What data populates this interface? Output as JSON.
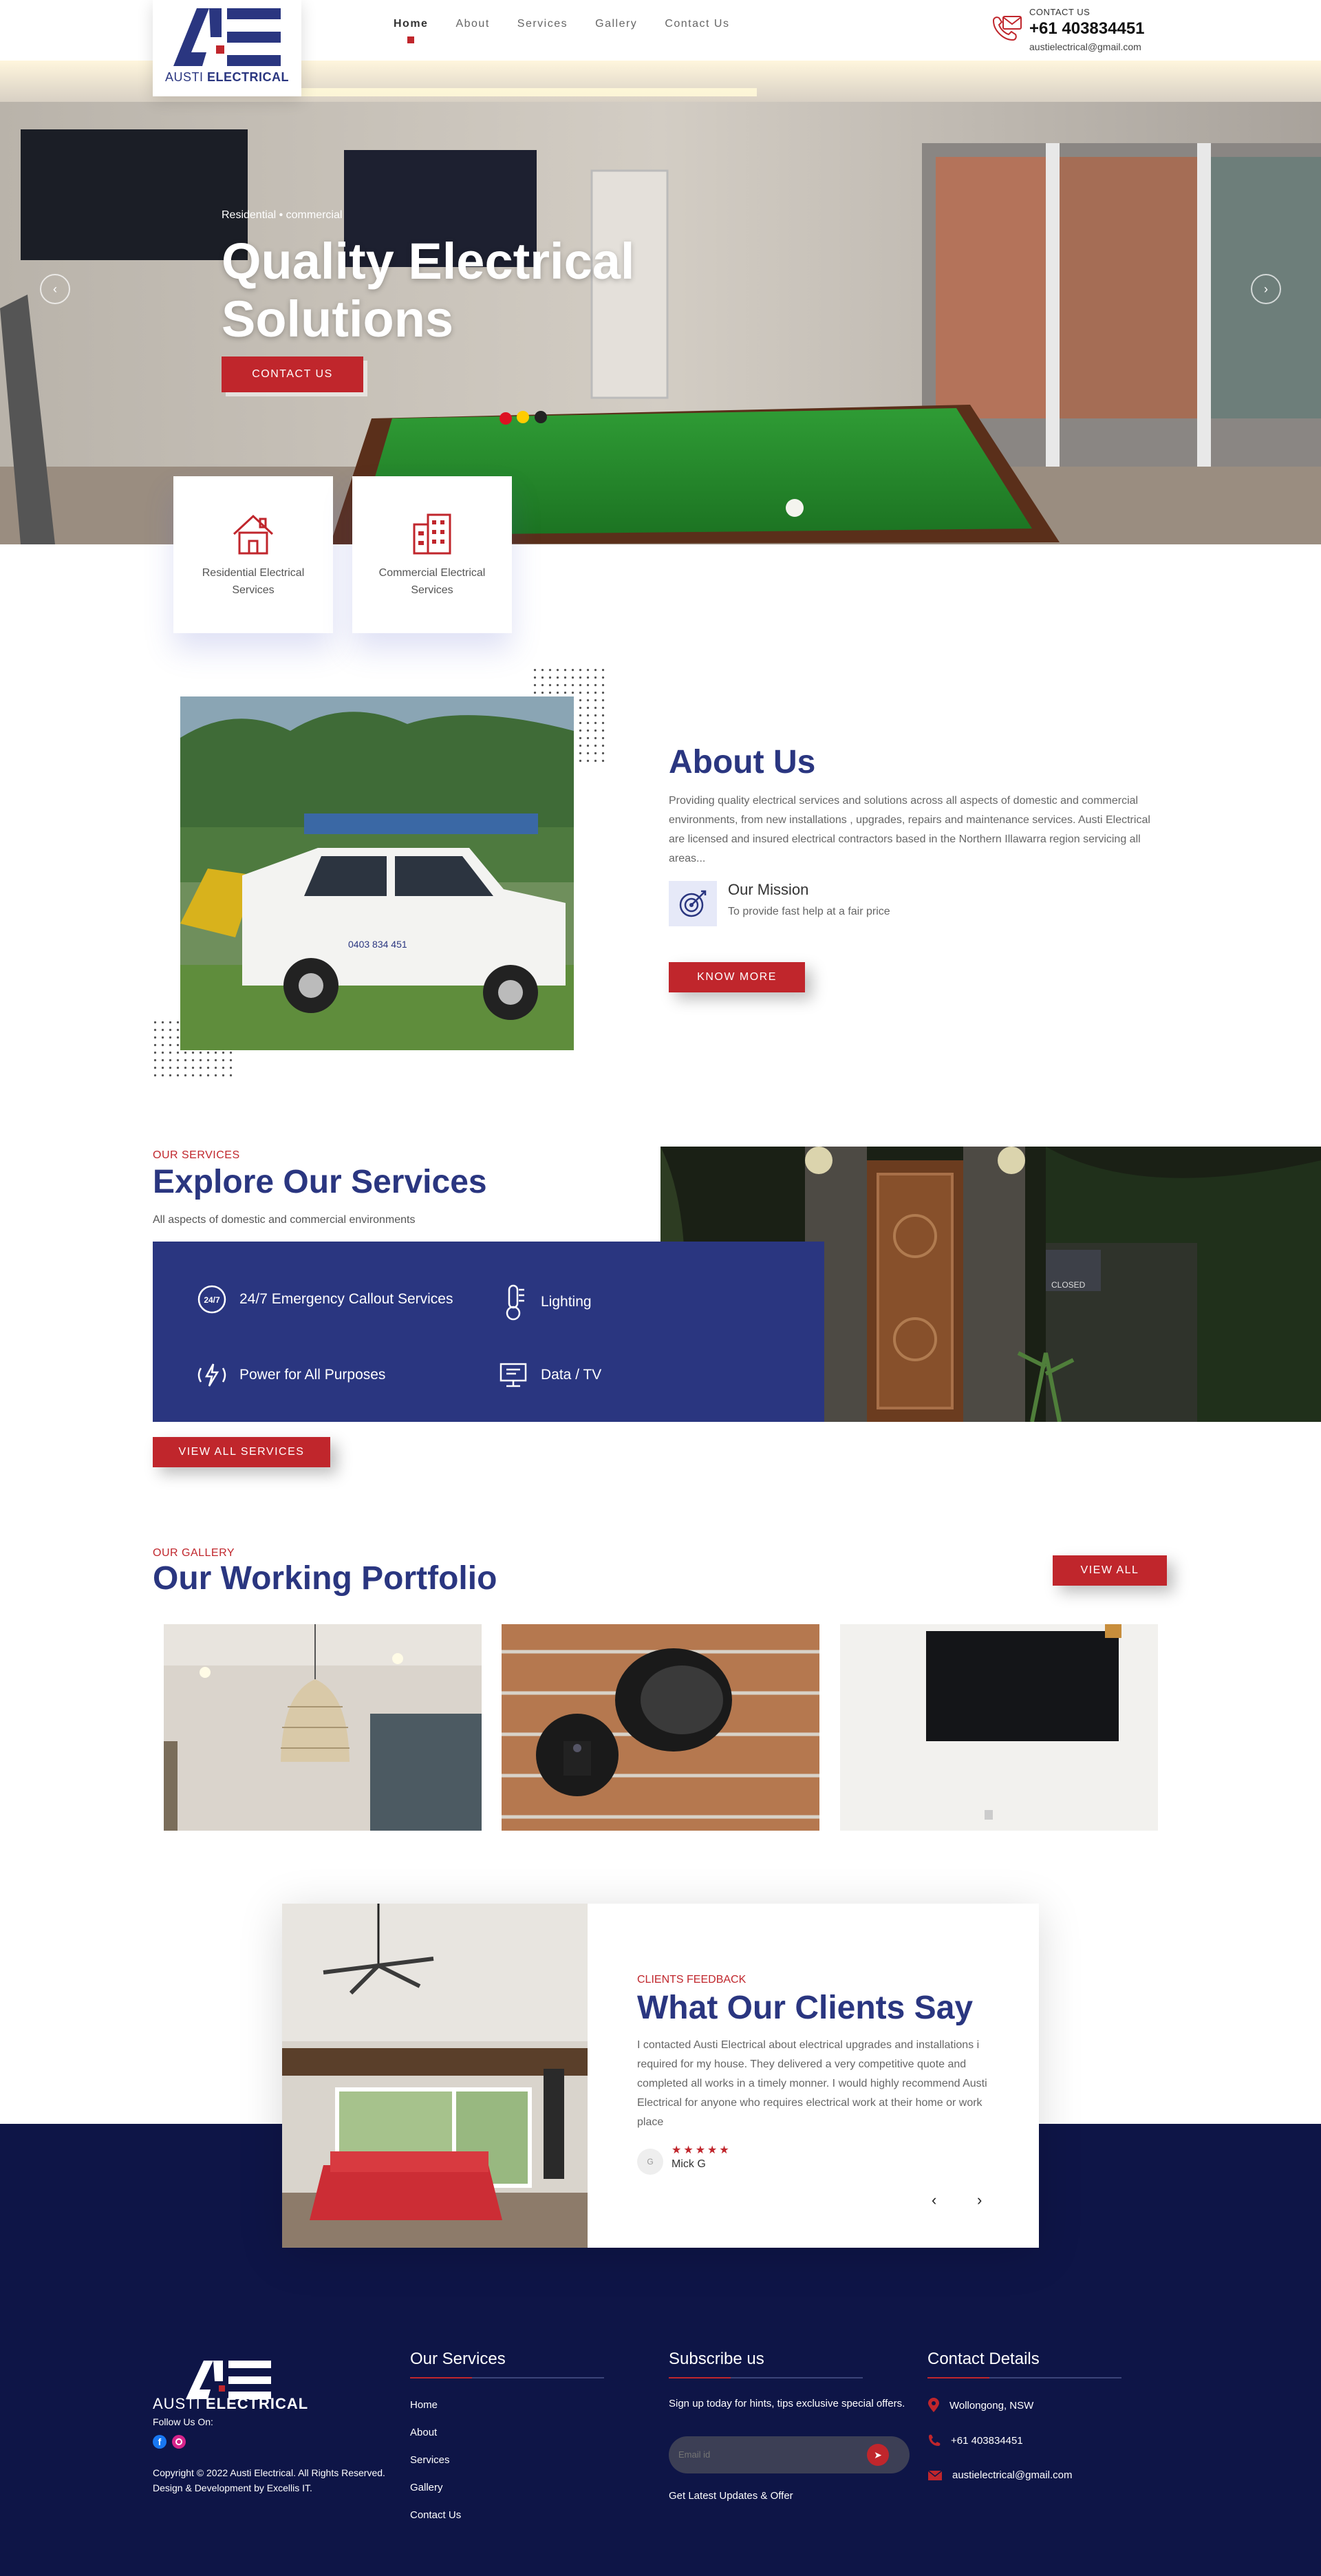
{
  "brand": {
    "name_light": "AUSTI",
    "name_bold": "ELECTRICAL"
  },
  "nav": {
    "items": [
      "Home",
      "About",
      "Services",
      "Gallery",
      "Contact Us"
    ],
    "active": "Home"
  },
  "contact_top": {
    "label": "CONTACT US",
    "phone": "+61 403834451",
    "email": "austielectrical@gmail.com"
  },
  "hero": {
    "subtitle": "Residential • commercial",
    "title": "Quality Electrical Solutions",
    "button": "CONTACT US"
  },
  "service_cards": [
    {
      "label": "Residential Electrical Services",
      "icon": "house-icon"
    },
    {
      "label": "Commercial Electrical Services",
      "icon": "office-building-icon"
    }
  ],
  "about": {
    "title": "About Us",
    "text": "Providing quality electrical services and solutions across all aspects of domestic and commercial environments, from new installations , upgrades, repairs and maintenance services. Austi Electrical are licensed and insured electrical contractors based in the Northern Illawarra region servicing all areas...",
    "mission_title": "Our Mission",
    "mission_text": "To provide fast help at a fair price",
    "button": "KNOW MORE",
    "van_text": "0403 834 451"
  },
  "services": {
    "eyebrow": "OUR SERVICES",
    "title": "Explore Our Services",
    "subtitle": "All aspects of domestic and commercial environments",
    "items": [
      {
        "label": "24/7 Emergency Callout Services",
        "icon": "24-7-icon"
      },
      {
        "label": "Lighting",
        "icon": "thermometer-icon"
      },
      {
        "label": "Power for All Purposes",
        "icon": "power-wave-icon"
      },
      {
        "label": "Data / TV",
        "icon": "monitor-icon"
      }
    ],
    "button": "VIEW ALL SERVICES",
    "door_sign": "CLOSED"
  },
  "gallery": {
    "eyebrow": "OUR GALLERY",
    "title": "Our Working Portfolio",
    "button": "VIEW ALL"
  },
  "testimonial": {
    "eyebrow": "CLIENTS FEEDBACK",
    "title": "What Our Clients Say",
    "text": "I contacted Austi Electrical about electrical upgrades and installations i required for my house. They delivered a very competitive quote and completed all works in a timely monner. I would highly recommend Austi Electrical for anyone who requires electrical work at their home or work place",
    "stars": "★★★★★",
    "rating": 5,
    "reviewer": "Mick G",
    "avatar": "G",
    "prev": "‹",
    "next": "›"
  },
  "footer": {
    "follow": "Follow Us On:",
    "copyright": "Copyright © 2022 Austi Electrical. All Rights Reserved. Design & Development by Excellis IT.",
    "services_title": "Our Services",
    "links": [
      "Home",
      "About",
      "Services",
      "Gallery",
      "Contact Us"
    ],
    "subscribe_title": "Subscribe us",
    "subscribe_text": "Sign up today for hints, tips exclusive special offers.",
    "email_placeholder": "Email id",
    "subscribe_note": "Get Latest Updates & Offer",
    "contact_title": "Contact Details",
    "location": "Wollongong, NSW",
    "phone": "+61 403834451",
    "email": "austielectrical@gmail.com"
  },
  "colors": {
    "navy": "#2a3680",
    "red": "#c0262c",
    "footer_bg": "#0e1547"
  }
}
